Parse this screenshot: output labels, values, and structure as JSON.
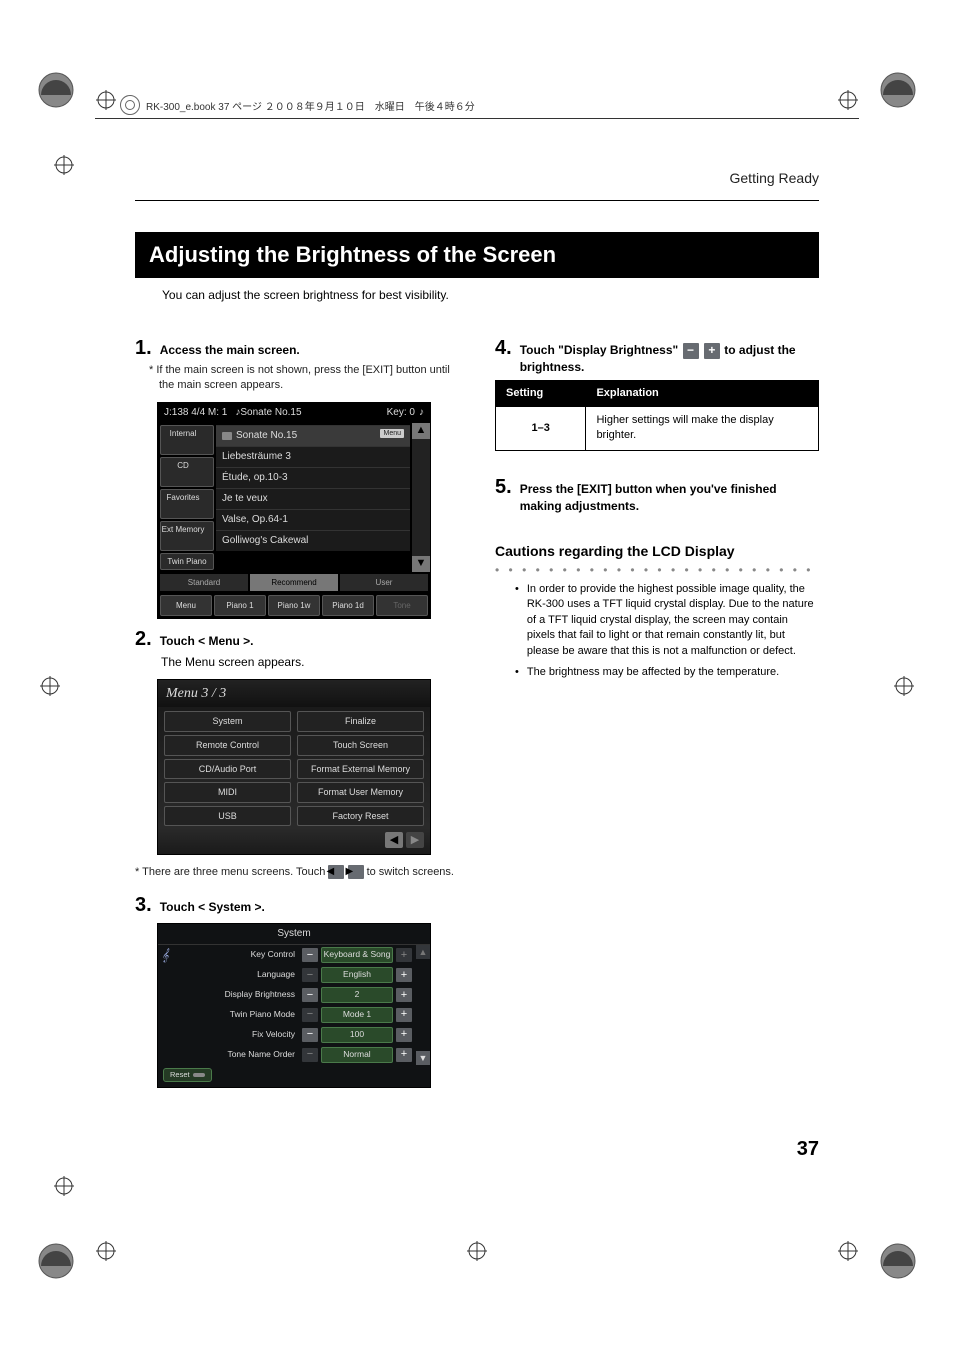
{
  "print_header": "RK-300_e.book 37 ページ ２００８年９月１０日　水曜日　午後４時６分",
  "running_head": "Getting Ready",
  "h1": "Adjusting the Brightness of the Screen",
  "intro": "You can adjust the screen brightness for best visibility.",
  "steps_left": {
    "s1": {
      "num": "1.",
      "text": "Access the main screen."
    },
    "s1_note": "*   If the main screen is not shown, press the [EXIT] button until the main screen appears.",
    "s2": {
      "num": "2.",
      "text": "Touch < Menu >."
    },
    "s2_plain": "The Menu screen appears.",
    "s2_note_pre": "*   There are three menu screens. Touch ",
    "s2_note_post": " to switch screens.",
    "s3": {
      "num": "3.",
      "text": "Touch < System >."
    }
  },
  "steps_right": {
    "s4": {
      "num": "4.",
      "pre": "Touch \"Display Brightness\" ",
      "post": " to adjust the brightness."
    },
    "s5": {
      "num": "5.",
      "text": "Press the [EXIT] button when you've finished making adjustments."
    }
  },
  "table": {
    "h1": "Setting",
    "h2": "Explanation",
    "r1c1": "1–3",
    "r1c2": "Higher settings will make the display brighter."
  },
  "caution_head": "Cautions regarding the LCD Display",
  "bullets": {
    "b1": "In order to provide the highest possible image quality, the RK-300 uses a TFT liquid crystal display. Due to the nature of a TFT liquid crystal display, the screen may contain pixels that fail to light or that remain constantly lit, but please be aware that this is not a malfunction or defect.",
    "b2": "The brightness may be affected by the temperature."
  },
  "scr1": {
    "top_left": "J:138    4/4    M:   1",
    "top_song_icon": "♪",
    "top_song": "Sonate No.15",
    "top_right": "Key: 0",
    "side": {
      "internal": "Internal",
      "cd": "CD",
      "fav": "Favorites",
      "ext": "Ext Memory",
      "twin": "Twin Piano"
    },
    "list": [
      "Sonate No.15",
      "Liebesträume 3",
      "Étude, op.10-3",
      "Je te veux",
      "Valse, Op.64-1",
      "Golliwog's Cakewal"
    ],
    "list0_pop": "Menu",
    "seg": [
      "Standard",
      "Recommend",
      "User"
    ],
    "bottom": [
      "Menu",
      "Piano 1",
      "Piano 1w",
      "Piano 1d",
      "Tone"
    ]
  },
  "scr2": {
    "title": "Menu 3 / 3",
    "items": [
      "System",
      "Finalize",
      "Remote Control",
      "Touch Screen",
      "CD/Audio Port",
      "Format External Memory",
      "MIDI",
      "Format User Memory",
      "USB",
      "Factory Reset"
    ]
  },
  "scr3": {
    "title": "System",
    "rows": [
      {
        "label": "Key Control",
        "val": "Keyboard & Song",
        "minus": true,
        "plus": false
      },
      {
        "label": "Language",
        "val": "English",
        "minus": false,
        "plus": true
      },
      {
        "label": "Display Brightness",
        "val": "2",
        "minus": true,
        "plus": true
      },
      {
        "label": "Twin Piano Mode",
        "val": "Mode 1",
        "minus": false,
        "plus": true
      },
      {
        "label": "Fix Velocity",
        "val": "100",
        "minus": true,
        "plus": true
      },
      {
        "label": "Tone Name Order",
        "val": "Normal",
        "minus": false,
        "plus": true
      }
    ],
    "reset": "Reset"
  },
  "page_num": "37"
}
